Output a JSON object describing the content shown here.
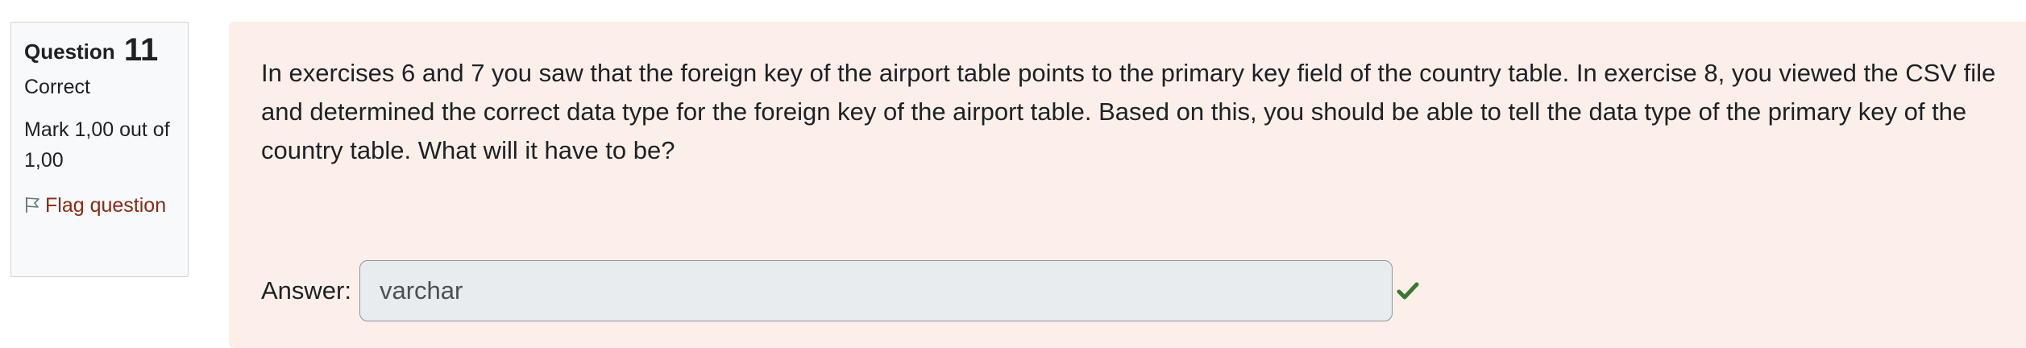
{
  "info": {
    "question_label": "Question",
    "question_number": "11",
    "state": "Correct",
    "grade": "Mark 1,00 out of 1,00",
    "flag_label": "Flag question"
  },
  "question": {
    "text": "In exercises 6 and 7 you saw that the foreign key of the airport table points to the primary key field of the country table. In exercise 8, you viewed the CSV file and determined the correct data type for the foreign key of the airport table. Based on this, you should be able to tell the data type of the primary key of the country table. What will it have to be?"
  },
  "answer": {
    "label": "Answer:",
    "value": "varchar",
    "feedback_icon": "check-icon"
  },
  "colors": {
    "content_background": "#fcefea",
    "info_background": "#f8f9fa",
    "flag_link": "#8a2a12",
    "correct": "#357a32"
  }
}
